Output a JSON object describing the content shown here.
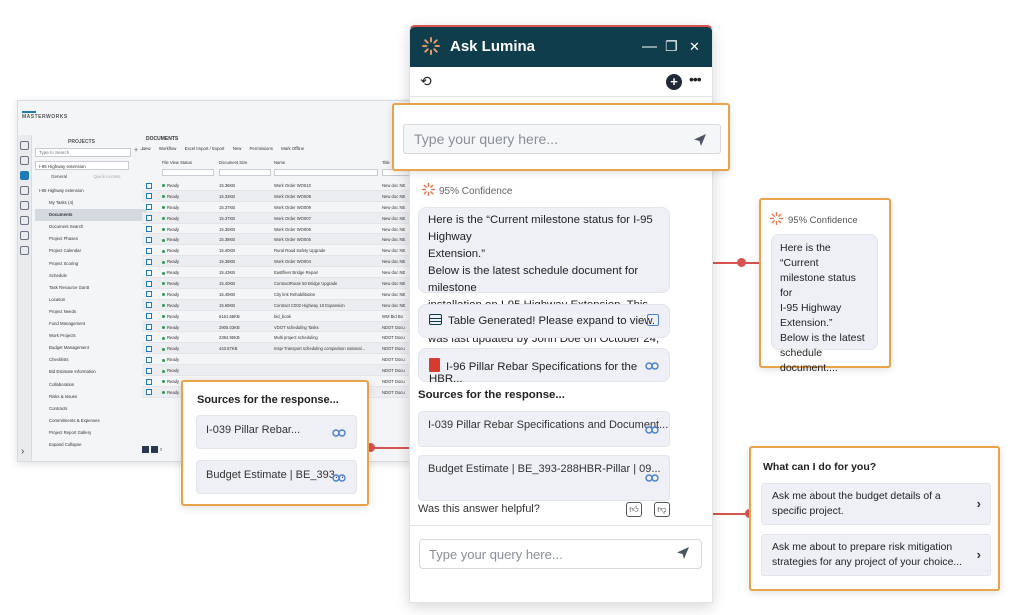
{
  "background_app": {
    "logo": "MASTERWORKS",
    "projects_title": "PROJECTS",
    "search_placeholder": "Type to Search",
    "project_select": "I-95 Highway extension",
    "tabs": [
      "General",
      "Quick Access"
    ],
    "tree": [
      {
        "label": "I-95 Highway extension",
        "selected": false
      },
      {
        "label": "My Tasks (4)",
        "selected": false
      },
      {
        "label": "Documents",
        "selected": true
      },
      {
        "label": "Document Search",
        "selected": false
      },
      {
        "label": "Project Phases",
        "selected": false
      },
      {
        "label": "Project Calendar",
        "selected": false
      },
      {
        "label": "Project Scoring",
        "selected": false
      },
      {
        "label": "Schedule",
        "selected": false
      },
      {
        "label": "Task Resource Gantt",
        "selected": false
      },
      {
        "label": "Location",
        "selected": false
      },
      {
        "label": "Project Needs",
        "selected": false
      },
      {
        "label": "Fund Management",
        "selected": false
      },
      {
        "label": "Work Projects",
        "selected": false
      },
      {
        "label": "Budget Management",
        "selected": false
      },
      {
        "label": "Checklists",
        "selected": false
      },
      {
        "label": "Bid Estimate Information",
        "selected": false
      },
      {
        "label": "Collaboration",
        "selected": false
      },
      {
        "label": "Risks & Issues",
        "selected": false
      },
      {
        "label": "Contracts",
        "selected": false
      },
      {
        "label": "Commitments & Expenses",
        "selected": false
      },
      {
        "label": "Project Report Gallery",
        "selected": false
      },
      {
        "label": "Expand Collapse",
        "selected": false
      }
    ],
    "docs_title": "DOCUMENTS",
    "toolbar": [
      "New",
      "Workflow",
      "Excel Import / Export",
      "New",
      "Permissions",
      "Mark Offline"
    ],
    "columns": [
      "File View Status",
      "Document Size",
      "Name",
      "Title"
    ],
    "rows": [
      {
        "status": "Ready",
        "size": "15.36KB",
        "name": "Work Order WO010",
        "title": "New doc NE"
      },
      {
        "status": "Ready",
        "size": "15.33KB",
        "name": "Work Order WO008",
        "title": "New doc NE"
      },
      {
        "status": "Ready",
        "size": "15.37KB",
        "name": "Work Order WO009",
        "title": "New doc NE"
      },
      {
        "status": "Ready",
        "size": "15.37KB",
        "name": "Work Order WO007",
        "title": "New doc NE"
      },
      {
        "status": "Ready",
        "size": "15.35KB",
        "name": "Work Order WO006",
        "title": "New doc NE"
      },
      {
        "status": "Ready",
        "size": "15.38KB",
        "name": "Work Order WO005",
        "title": "New doc NE"
      },
      {
        "status": "Ready",
        "size": "15.40KB",
        "name": "Rural Road Safety Upgrade",
        "title": "New doc NE"
      },
      {
        "status": "Ready",
        "size": "15.38KB",
        "name": "Work Order WO004",
        "title": "New doc NE"
      },
      {
        "status": "Ready",
        "size": "15.43KB",
        "name": "Eastfliver Bridge Repair",
        "title": "New doc NE"
      },
      {
        "status": "Ready",
        "size": "15.40KB",
        "name": "ContractRoute 50 Bridge Upgrade",
        "title": "New doc NE"
      },
      {
        "status": "Ready",
        "size": "15.49KB",
        "name": "City link Rehabilitation",
        "title": "New doc NE"
      },
      {
        "status": "Ready",
        "size": "15.69KB",
        "name": "Contract C002 Highway 10 Expansion",
        "title": "New doc NE"
      },
      {
        "status": "Ready",
        "size": "5161.68KB",
        "name": "bid_book",
        "title": "WM Bid Bo"
      },
      {
        "status": "Ready",
        "size": "2905.03KB",
        "name": "VDOT scheduling Tasks",
        "title": "NDOT Docu"
      },
      {
        "status": "Ready",
        "size": "2384.95KB",
        "name": "Multi project scheduling",
        "title": "NDOT Docu"
      },
      {
        "status": "Ready",
        "size": "443.87KB",
        "name": "Inspi Transport scheduling comparison national...",
        "title": "NDOT Docu"
      },
      {
        "status": "Ready",
        "size": "",
        "name": "",
        "title": "NDOT Docu"
      },
      {
        "status": "Ready",
        "size": "",
        "name": "",
        "title": "NDOT Docu"
      },
      {
        "status": "Ready",
        "size": "",
        "name": "",
        "title": "NDOT Docu"
      },
      {
        "status": "Ready",
        "size": "",
        "name": "",
        "title": "NDOT Docu"
      }
    ],
    "pager_page": "2"
  },
  "chat": {
    "title": "Ask Lumina",
    "window_controls": [
      "—",
      "❐",
      "✕"
    ],
    "confidence": "95% Confidence",
    "message": "Here is the “Current milestone status for I-95 Highway Extension.” Below is the latest schedule document for milestone installation on I-95 Highway Extension. This document was last updated by John Doe on October 24, 2024:",
    "message_lines": [
      "Here is the “Current milestone status for I-95 Highway",
      "Extension.”",
      "Below is the latest schedule document for milestone",
      "installation on I-95 Highway Extension. This document",
      "was last updated by John Doe on October 24, 2024:"
    ],
    "table_card": "Table Generated! Please expand to view.",
    "pdf_card": "I-96 Pillar Rebar Specifications for the HBR...",
    "sources_title": "Sources for the response...",
    "sources": [
      "I-039 Pillar Rebar Specifications and Document...",
      "Budget Estimate | BE_393-288HBR-Pillar | 09..."
    ],
    "helpful": "Was this answer helpful?",
    "input_placeholder": "Type your query here..."
  },
  "callouts": {
    "query_placeholder": "Type your query here...",
    "confidence": "95% Confidence",
    "message_lines": [
      "Here is the “Current",
      "milestone status for",
      "I-95 Highway",
      "Extension.”",
      "Below is the latest",
      "schedule",
      "document...."
    ],
    "sources_title": "Sources for the response...",
    "sources": [
      "I-039 Pillar Rebar...",
      "Budget Estimate | BE_393..."
    ],
    "help_title": "What can I do for you?",
    "suggestions": [
      "Ask me about the budget details of a specific project.",
      "Ask me about to prepare risk mitigation strategies for any project of your choice..."
    ]
  },
  "colors": {
    "header": "#0f3d4c",
    "accent_orange": "#e9a34a",
    "connector_red": "#d9534f",
    "bubble": "#eef0f6"
  },
  "icons": [
    "lumina-logo-icon",
    "history-icon",
    "new-chat-icon",
    "more-icon",
    "table-icon",
    "expand-icon",
    "pdf-icon",
    "link-icon",
    "thumbs-up-icon",
    "thumbs-down-icon",
    "send-icon",
    "chevron-right-icon"
  ]
}
